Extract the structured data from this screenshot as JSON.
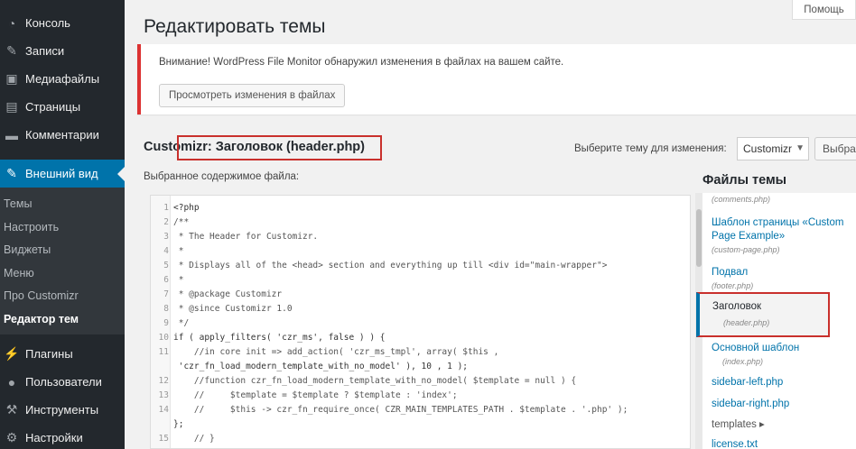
{
  "sidebar": {
    "items": [
      {
        "label": "Консоль",
        "icon": "dashboard-icon",
        "glyph": "◔"
      },
      {
        "label": "Записи",
        "icon": "pin-icon",
        "glyph": "✎"
      },
      {
        "label": "Медиафайлы",
        "icon": "media-icon",
        "glyph": "▣"
      },
      {
        "label": "Страницы",
        "icon": "pages-icon",
        "glyph": "▤"
      },
      {
        "label": "Комментарии",
        "icon": "comments-icon",
        "glyph": "▬"
      },
      {
        "label": "Внешний вид",
        "icon": "appearance-icon",
        "glyph": "✎"
      }
    ],
    "submenu": [
      "Темы",
      "Настроить",
      "Виджеты",
      "Меню",
      "Про Customizr",
      "Редактор тем"
    ],
    "bottom": [
      {
        "label": "Плагины",
        "icon": "plugins-icon",
        "glyph": "⚡"
      },
      {
        "label": "Пользователи",
        "icon": "users-icon",
        "glyph": "●"
      },
      {
        "label": "Инструменты",
        "icon": "tools-icon",
        "glyph": "⚒"
      },
      {
        "label": "Настройки",
        "icon": "settings-icon",
        "glyph": "⚙"
      }
    ]
  },
  "help_label": "Помощь",
  "page_title": "Редактировать темы",
  "notice": {
    "text": "Внимание! WordPress File Monitor обнаружил изменения в файлах на вашем сайте.",
    "button": "Просмотреть изменения в файлах"
  },
  "file_title": "Customizr: Заголовок (header.php)",
  "select_label": "Выберите тему для изменения:",
  "theme_select": "Customizr",
  "select_button": "Выбра",
  "content_label": "Выбранное содержимое файла:",
  "theme_files_heading": "Файлы темы",
  "code_lines": [
    {
      "n": "1",
      "t": "<?php"
    },
    {
      "n": "2",
      "t": "/**"
    },
    {
      "n": "3",
      "t": " * The Header for Customizr."
    },
    {
      "n": "4",
      "t": " *"
    },
    {
      "n": "5",
      "t": " * Displays all of the <head> section and everything up till <div id=\"main-wrapper\">"
    },
    {
      "n": "6",
      "t": " *"
    },
    {
      "n": "7",
      "t": " * @package Customizr"
    },
    {
      "n": "8",
      "t": " * @since Customizr 1.0"
    },
    {
      "n": "9",
      "t": " */"
    },
    {
      "n": "10",
      "t": "if ( apply_filters( 'czr_ms', false ) ) {"
    },
    {
      "n": "11",
      "t": "    //in core init => add_action( 'czr_ms_tmpl', array( $this ,"
    },
    {
      "n": "",
      "t": " 'czr_fn_load_modern_template_with_no_model' ), 10 , 1 );"
    },
    {
      "n": "12",
      "t": "    //function czr_fn_load_modern_template_with_no_model( $template = null ) {"
    },
    {
      "n": "13",
      "t": "    //     $template = $template ? $template : 'index';"
    },
    {
      "n": "14",
      "t": "    //     $this -> czr_fn_require_once( CZR_MAIN_TEMPLATES_PATH . $template . '.php' );"
    },
    {
      "n": "",
      "t": "};"
    },
    {
      "n": "15",
      "t": "    // }"
    }
  ],
  "files": [
    {
      "name": "",
      "sub": "(comments.php)"
    },
    {
      "name": "Шаблон страницы «Custom",
      "name2": "Page Example»",
      "sub": "(custom-page.php)"
    },
    {
      "name": "Подвал",
      "sub": "(footer.php)"
    },
    {
      "name": "Заголовок",
      "sub": "(header.php)"
    },
    {
      "name": "Основной шаблон",
      "sub": "(index.php)"
    },
    {
      "name": "sidebar-left.php",
      "sub": ""
    },
    {
      "name": "sidebar-right.php",
      "sub": ""
    },
    {
      "name": "templates ▸",
      "sub": ""
    },
    {
      "name": "license.txt",
      "sub": ""
    }
  ]
}
